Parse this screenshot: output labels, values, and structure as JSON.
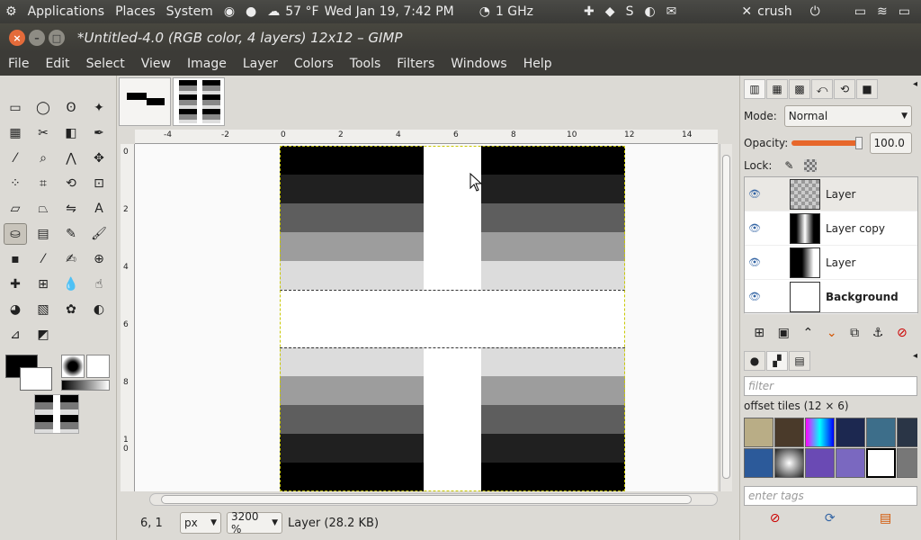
{
  "topbar": {
    "applications": "Applications",
    "places": "Places",
    "system": "System",
    "weather": "57 °F",
    "datetime": "Wed Jan 19,  7:42 PM",
    "cpu": "1 GHz",
    "user": "crush"
  },
  "window": {
    "title": "*Untitled-4.0 (RGB color, 4 layers) 12x12 – GIMP"
  },
  "menu": [
    "File",
    "Edit",
    "Select",
    "View",
    "Image",
    "Layer",
    "Colors",
    "Tools",
    "Filters",
    "Windows",
    "Help"
  ],
  "ruler": {
    "h_ticks": [
      "-4",
      "-2",
      "0",
      "2",
      "4",
      "6",
      "8",
      "10",
      "12",
      "14"
    ],
    "v_ticks": [
      "0",
      "2",
      "4",
      "6",
      "8",
      "1 0"
    ]
  },
  "status": {
    "coords": "6, 1",
    "unit": "px",
    "zoom": "3200 %",
    "layer_info": "Layer (28.2 KB)"
  },
  "layers_panel": {
    "mode_label": "Mode:",
    "mode_value": "Normal",
    "opacity_label": "Opacity:",
    "opacity_value": "100.0",
    "lock_label": "Lock:",
    "layers": [
      {
        "name": "Layer"
      },
      {
        "name": "Layer copy"
      },
      {
        "name": "Layer"
      },
      {
        "name": "Background"
      }
    ]
  },
  "patterns_panel": {
    "filter_placeholder": "filter",
    "title": "offset tiles (12 × 6)",
    "tags_placeholder": "enter tags"
  },
  "colors": {
    "accent": "#e46b3a",
    "panel_bg": "#dcdad5",
    "menubar": "#3c3b37"
  }
}
